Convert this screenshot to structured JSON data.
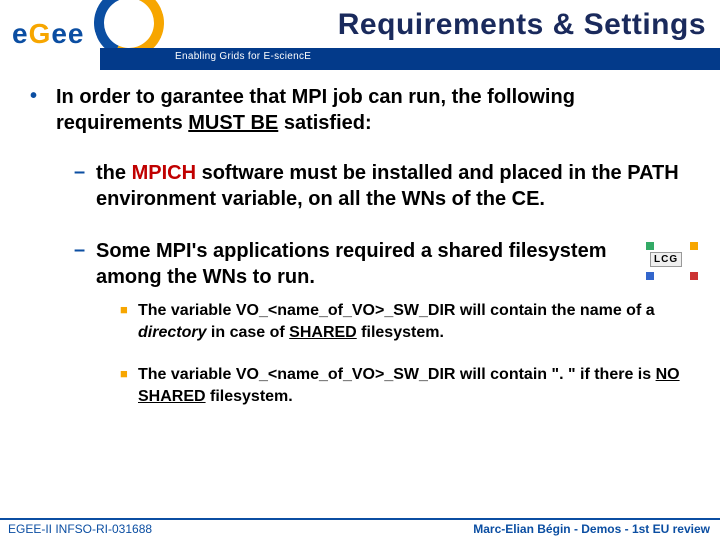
{
  "header": {
    "title": "Requirements & Settings",
    "tagline": "Enabling Grids for E-sciencE",
    "logo_text_1": "e",
    "logo_text_2": "G",
    "logo_text_3": "ee"
  },
  "body": {
    "intro_pre": "In order to garantee that MPI job can run, the following requirements ",
    "intro_must": "MUST BE",
    "intro_post": " satisfied:",
    "r1_pre": "the ",
    "r1_mpich": "MPICH",
    "r1_post": " software must be installed and placed in the PATH environment variable, on all the WNs of the CE.",
    "r2": "Some MPI's applications required a shared filesystem among the WNs to run.",
    "s1_a": "The variable ",
    "s1_var": "VO_<name_of_VO>_SW_DIR",
    "s1_b": " will contain the name of a ",
    "s1_dir": "directory",
    "s1_c": " in case of ",
    "s1_shared": "SHARED",
    "s1_d": " filesystem.",
    "s2_a": "The variable ",
    "s2_var": "VO_<name_of_VO>_SW_DIR",
    "s2_b": " will contain ",
    "s2_dot": "\". \"",
    "s2_c": " if there is ",
    "s2_ns": "NO SHARED",
    "s2_d": " filesystem."
  },
  "lcg": {
    "label": "LCG"
  },
  "footer": {
    "left": "EGEE-II INFSO-RI-031688",
    "right": "Marc-Elian Bégin - Demos - 1st EU review"
  }
}
